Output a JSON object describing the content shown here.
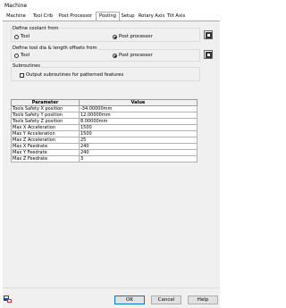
{
  "window": {
    "title": "Machine"
  },
  "tabs": [
    {
      "label": "Machine"
    },
    {
      "label": "Tool Crib"
    },
    {
      "label": "Post Processor"
    },
    {
      "label": "Posting",
      "active": true
    },
    {
      "label": "Setup"
    },
    {
      "label": "Rotary Axis"
    },
    {
      "label": "Tilt Axis"
    }
  ],
  "coolant": {
    "group_label": "Define coolant from",
    "options": [
      {
        "label": "Tool",
        "selected": false
      },
      {
        "label": "Post processor",
        "selected": true
      }
    ]
  },
  "offsets": {
    "group_label": "Define tool dia & length offsets from",
    "options": [
      {
        "label": "Tool",
        "selected": false
      },
      {
        "label": "Post processor",
        "selected": true
      }
    ]
  },
  "subroutines": {
    "group_label": "Subroutines",
    "checkbox_label": "Output subroutines for patterned features",
    "checked": false
  },
  "table": {
    "headers": [
      "Parameter",
      "Value"
    ],
    "rows": [
      [
        "Tools Safety X position",
        "-34.00000mm"
      ],
      [
        "Tools Safety Y position",
        "12.00000mm"
      ],
      [
        "Tools Safety Z position",
        "8.00000mm"
      ],
      [
        "Max X Acceleration",
        "1500"
      ],
      [
        "Max Y Acceleration",
        "1500"
      ],
      [
        "Max Z Acceleration",
        "25"
      ],
      [
        "Max X Feedrate",
        "240"
      ],
      [
        "Max Y Feedrate",
        "240"
      ],
      [
        "Max Z Feedrate",
        "3"
      ]
    ]
  },
  "buttons": {
    "ok": "OK",
    "cancel": "Cancel",
    "help": "Help"
  },
  "colors": {
    "panel": "#f0f0f0",
    "ok_border": "#0078d7"
  }
}
